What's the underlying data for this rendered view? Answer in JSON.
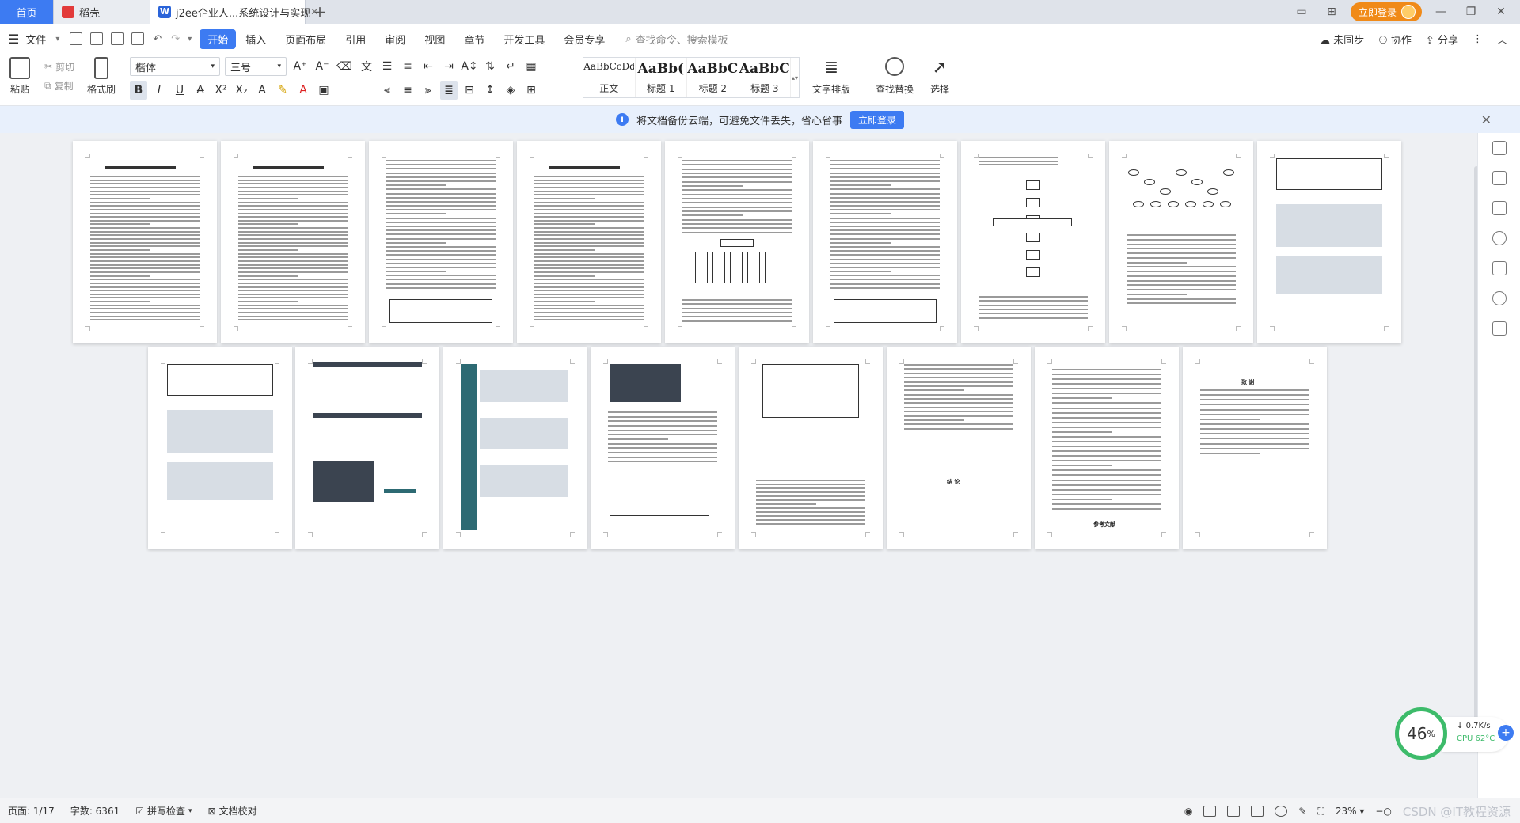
{
  "tabs": {
    "home": "首页",
    "daoke": "稻壳",
    "doc": "j2ee企业人...系统设计与实现",
    "add": "+"
  },
  "titlebar": {
    "login": "立即登录"
  },
  "menu": {
    "file": "文件",
    "items": [
      "开始",
      "插入",
      "页面布局",
      "引用",
      "审阅",
      "视图",
      "章节",
      "开发工具",
      "会员专享"
    ],
    "search_placeholder": "查找命令、搜索模板",
    "sync": "未同步",
    "collab": "协作",
    "share": "分享"
  },
  "ribbon": {
    "paste": "粘贴",
    "cut": "剪切",
    "copy": "复制",
    "format_painter": "格式刷",
    "font_name": "楷体",
    "font_size": "三号",
    "styles": [
      {
        "sample": "AaBbCcDd",
        "label": "正文"
      },
      {
        "sample": "AaBb(",
        "label": "标题 1"
      },
      {
        "sample": "AaBbC",
        "label": "标题 2"
      },
      {
        "sample": "AaBbC",
        "label": "标题 3"
      }
    ],
    "text_layout": "文字排版",
    "find_replace": "查找替换",
    "select": "选择"
  },
  "notice": {
    "text": "将文档备份云端，可避免文件丢失，省心省事",
    "button": "立即登录"
  },
  "doc_pages": {
    "page19_heading": "结  论",
    "page21_heading": "参考文献",
    "page24_heading": "致  谢"
  },
  "perf": {
    "percent": "46",
    "unit": "%",
    "speed": "0.7K/s",
    "cpu": "CPU 62°C"
  },
  "status": {
    "page": "页面: 1/17",
    "words": "字数: 6361",
    "spell": "拼写检查",
    "proof": "文档校对",
    "zoom": "23%",
    "watermark": "CSDN @IT教程资源"
  }
}
